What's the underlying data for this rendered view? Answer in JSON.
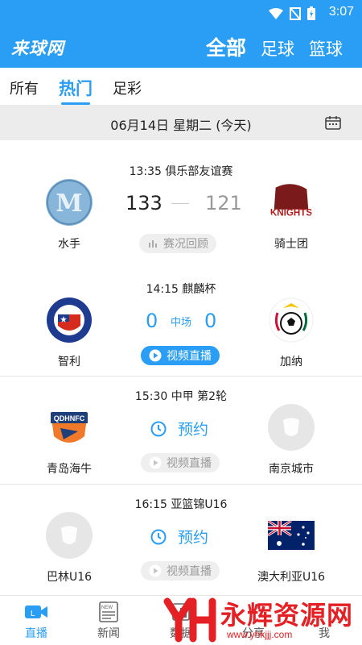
{
  "status_bar": {
    "time": "3:07"
  },
  "app_bar": {
    "logo": "来球网",
    "tabs": [
      "全部",
      "足球",
      "篮球"
    ]
  },
  "sub_tabs": [
    "所有",
    "热门",
    "足彩"
  ],
  "date_bar": {
    "date": "06月14日 星期二 (今天)"
  },
  "matches": [
    {
      "title": "13:35 俱乐部友谊赛",
      "home": "水手",
      "away": "骑士团",
      "home_score": "133",
      "away_score": "121",
      "action": "赛况回顾"
    },
    {
      "title": "14:15 麒麟杯",
      "home": "智利",
      "away": "加纳",
      "home_score": "0",
      "away_score": "0",
      "status": "中场",
      "action": "视频直播"
    },
    {
      "title": "15:30 中甲 第2轮",
      "home": "青岛海牛",
      "away": "南京城市",
      "reserve": "预约",
      "action": "视频直播"
    },
    {
      "title": "16:15 亚篮锦U16",
      "home": "巴林U16",
      "away": "澳大利亚U16",
      "reserve": "预约",
      "action": "视频直播"
    }
  ],
  "bottom_nav": [
    "直播",
    "新闻",
    "数据",
    "分享",
    "我"
  ],
  "watermark": {
    "text": "永辉资源网",
    "url": "www.yhkjjj.com"
  },
  "colors": {
    "primary": "#2a9df4",
    "watermark": "#e42024"
  }
}
